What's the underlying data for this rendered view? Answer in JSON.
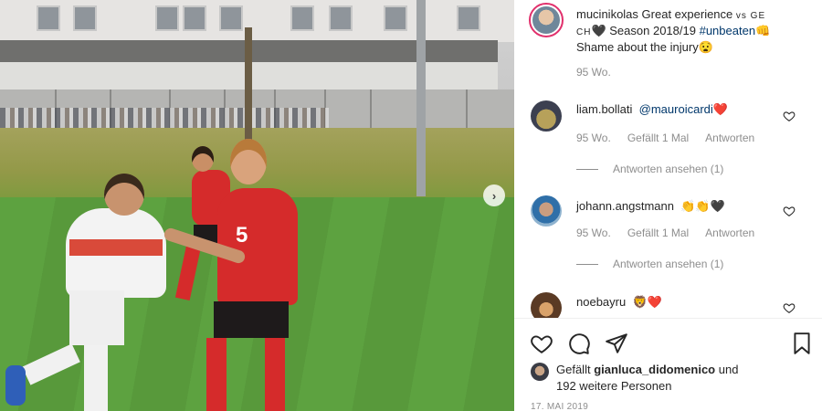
{
  "post": {
    "owner": "mucinikolas",
    "caption_parts": {
      "text_before": "Great experience",
      "vs_text": "vs GE CH",
      "season": "Season 2018/19",
      "hashtag": "#unbeaten",
      "text_after": "Shame about the injury"
    },
    "emojis": {
      "black_heart": "🖤",
      "fist": "👊",
      "sad": "😧"
    },
    "time_ago": "95 Wo.",
    "photo_jersey_number": "5"
  },
  "comments": [
    {
      "username": "liam.bollati",
      "mention": "@mauroicardi",
      "emoji": "❤️",
      "time": "95 Wo.",
      "likes": "Gefällt 1 Mal",
      "reply": "Antworten",
      "view_replies": "Antworten ansehen (1)"
    },
    {
      "username": "johann.angstmann",
      "emoji": "👏👏🖤",
      "time": "95 Wo.",
      "likes": "Gefällt 1 Mal",
      "reply": "Antworten",
      "view_replies": "Antworten ansehen (1)"
    },
    {
      "username": "noebayru",
      "emoji": "🦁❤️"
    }
  ],
  "footer": {
    "liked_by_prefix": "Gefällt",
    "liked_by_user": "gianluca_didomenico",
    "liked_by_conj": "und",
    "others": "192 weitere Personen",
    "date": "17. MAI 2019"
  },
  "icons": {
    "next": "chevron-right-icon",
    "like": "heart-icon",
    "comment": "comment-icon",
    "share": "send-icon",
    "save": "bookmark-icon"
  },
  "colors": {
    "link": "#00376b",
    "muted": "#8e8e8e",
    "story_ring": "#e1306c",
    "red_heart": "#e0245e"
  }
}
